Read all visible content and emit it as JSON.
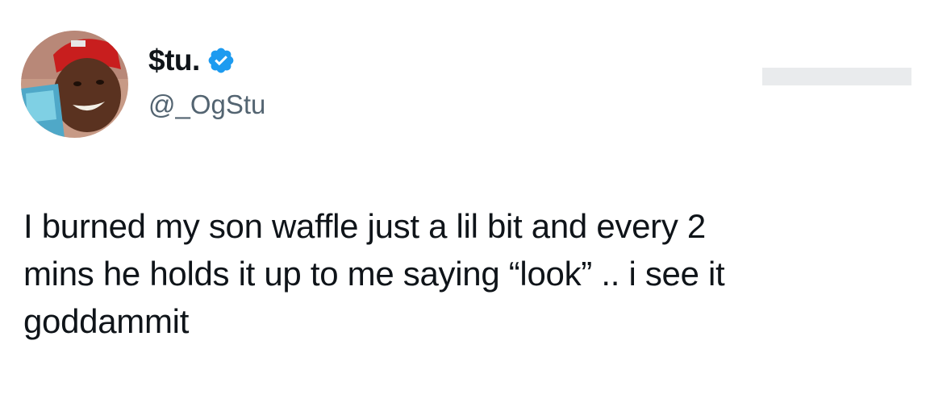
{
  "author": {
    "display_name": "$tu.",
    "handle": "@_OgStu",
    "verified": true,
    "avatar_icon": "profile-photo-avatar"
  },
  "tweet": {
    "lines": [
      "I burned my son waffle just a lil bit and every 2",
      "mins he holds it up to me saying “look” .. i see it",
      "goddammit"
    ]
  },
  "colors": {
    "text_primary": "#0f1419",
    "text_secondary": "#536471",
    "verified_blue": "#1d9bf0",
    "background": "#ffffff"
  }
}
